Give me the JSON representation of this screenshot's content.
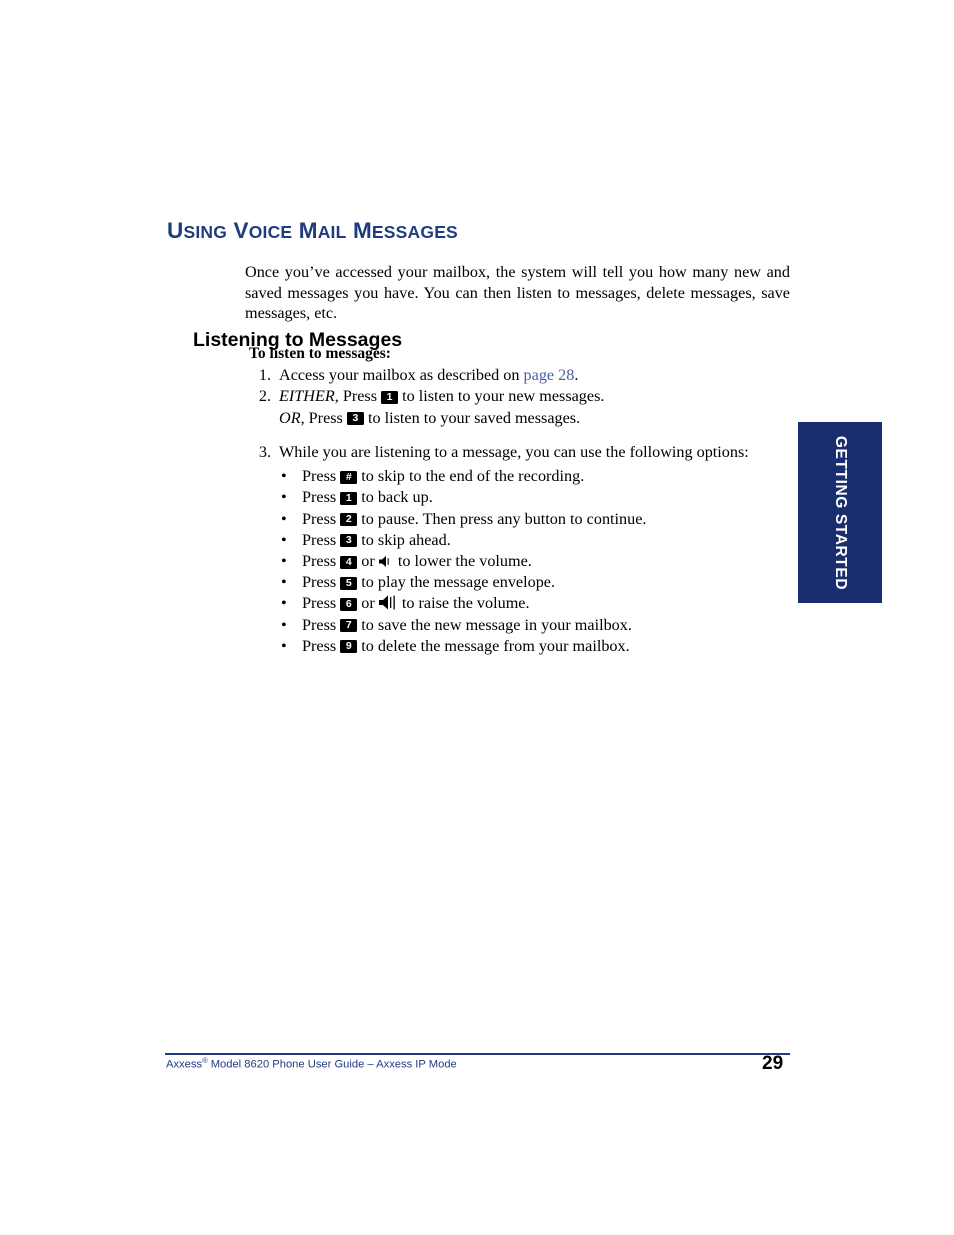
{
  "chapter": {
    "heading_parts": [
      {
        "text": "U",
        "small": false
      },
      {
        "text": "SING",
        "small": true
      },
      {
        "text": " V",
        "small": false
      },
      {
        "text": "OICE",
        "small": true
      },
      {
        "text": " M",
        "small": false
      },
      {
        "text": "AIL",
        "small": true
      },
      {
        "text": " M",
        "small": false
      },
      {
        "text": "ESSAGES",
        "small": true
      }
    ],
    "heading_plain": "USING VOICE MAIL MESSAGES",
    "heading_color": "#1F3C80"
  },
  "intro": {
    "paragraph": "Once you’ve accessed your mailbox, the system will tell you how many new and saved messages you have. You can then listen to messages, delete messages, save messages, etc."
  },
  "section": {
    "sub_heading": "Listening to Messages",
    "procedure_title": "To listen to messages:"
  },
  "steps": [
    {
      "marker": "1.",
      "segments": [
        {
          "type": "text",
          "value": "Access your mailbox as described on "
        },
        {
          "type": "link",
          "value": "page 28"
        },
        {
          "type": "text",
          "value": "."
        }
      ]
    },
    {
      "marker": "2.",
      "segments": [
        {
          "type": "italic",
          "value": "EITHER"
        },
        {
          "type": "text",
          "value": ", Press "
        },
        {
          "type": "key",
          "value": "1"
        },
        {
          "type": "text",
          "value": " to listen to your new messages."
        }
      ],
      "sub_segments": [
        {
          "type": "italic",
          "value": "OR"
        },
        {
          "type": "text",
          "value": ", Press "
        },
        {
          "type": "key",
          "value": "3"
        },
        {
          "type": "text",
          "value": " to listen to your saved messages."
        }
      ]
    },
    {
      "marker": "3.",
      "segments": [
        {
          "type": "text",
          "value": "While you are listening to a message, you can use the following options:"
        }
      ]
    }
  ],
  "options": [
    {
      "bullet": "•",
      "segments": [
        {
          "type": "text",
          "value": "Press "
        },
        {
          "type": "key",
          "value": "#"
        },
        {
          "type": "text",
          "value": " to skip to the end of the recording."
        }
      ]
    },
    {
      "bullet": "•",
      "segments": [
        {
          "type": "text",
          "value": "Press "
        },
        {
          "type": "key",
          "value": "1"
        },
        {
          "type": "text",
          "value": " to back up."
        }
      ]
    },
    {
      "bullet": "•",
      "segments": [
        {
          "type": "text",
          "value": "Press "
        },
        {
          "type": "key",
          "value": "2"
        },
        {
          "type": "text",
          "value": " to pause. Then press any button to continue."
        }
      ]
    },
    {
      "bullet": "•",
      "segments": [
        {
          "type": "text",
          "value": "Press "
        },
        {
          "type": "key",
          "value": "3"
        },
        {
          "type": "text",
          "value": " to skip ahead."
        }
      ]
    },
    {
      "bullet": "•",
      "segments": [
        {
          "type": "text",
          "value": "Press "
        },
        {
          "type": "key",
          "value": "4"
        },
        {
          "type": "text",
          "value": " or "
        },
        {
          "type": "icon",
          "value": "volume-down-icon"
        },
        {
          "type": "text",
          "value": " to lower the volume."
        }
      ]
    },
    {
      "bullet": "•",
      "segments": [
        {
          "type": "text",
          "value": "Press "
        },
        {
          "type": "key",
          "value": "5"
        },
        {
          "type": "text",
          "value": " to play the message envelope."
        }
      ]
    },
    {
      "bullet": "•",
      "segments": [
        {
          "type": "text",
          "value": "Press "
        },
        {
          "type": "key",
          "value": "6"
        },
        {
          "type": "text",
          "value": " or "
        },
        {
          "type": "icon",
          "value": "volume-up-icon"
        },
        {
          "type": "text",
          "value": " to raise the volume."
        }
      ]
    },
    {
      "bullet": "•",
      "segments": [
        {
          "type": "text",
          "value": "Press "
        },
        {
          "type": "key",
          "value": "7"
        },
        {
          "type": "text",
          "value": " to save the new message in your mailbox."
        }
      ]
    },
    {
      "bullet": "•",
      "segments": [
        {
          "type": "text",
          "value": "Press "
        },
        {
          "type": "key",
          "value": "9"
        },
        {
          "type": "text",
          "value": " to delete the message from your mailbox."
        }
      ]
    }
  ],
  "side_tab": {
    "label": "GETTING STARTED",
    "background": "#182E6E",
    "text_color": "#FFFFFF"
  },
  "footer": {
    "product": "Axxess",
    "registered_mark": "®",
    "description": " Model 8620 Phone User Guide – Axxess IP Mode",
    "page_number": "29",
    "rule_color": "#1F3C80",
    "text_color": "#1F3C80"
  }
}
